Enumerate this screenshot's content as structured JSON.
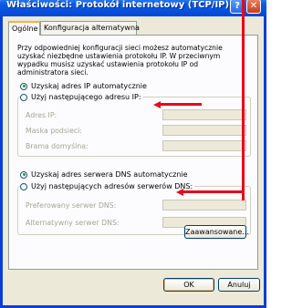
{
  "window": {
    "title": "Właściwości: Protokół internetowy (TCP/IP)",
    "help_glyph": "?",
    "close_glyph": "✕"
  },
  "tabs": [
    {
      "label": "Ogólne",
      "active": true
    },
    {
      "label": "Konfiguracja alternatywna",
      "active": false
    }
  ],
  "panel": {
    "description": "Przy odpowiedniej konfiguracji sieci możesz automatycznie uzyskać niezbędne ustawienia protokołu IP. W przeciwnym wypadku musisz uzyskać ustawienia protokołu IP od administratora sieci.",
    "ip_auto_label": "Uzyskaj adres IP automatycznie",
    "ip_manual_label": "Użyj następującego adresu IP:",
    "ip_fields": [
      {
        "label": "Adres IP:"
      },
      {
        "label": "Maska podsieci:"
      },
      {
        "label": "Brama domyślna:"
      }
    ],
    "dns_auto_label": "Uzyskaj adres serwera DNS automatycznie",
    "dns_manual_label": "Użyj następujących adresów serwerów DNS:",
    "dns_fields": [
      {
        "label": "Preferowany serwer DNS:"
      },
      {
        "label": "Alternatywny serwer DNS:"
      }
    ],
    "advanced_button": "Zaawansowane..."
  },
  "footer": {
    "ok_button": "OK",
    "cancel_button": "Anuluj"
  },
  "annotation_color": "#e8091b",
  "titlebar_color": "#0a5ae6"
}
